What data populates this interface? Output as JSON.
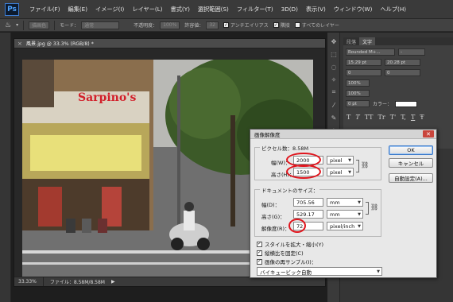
{
  "app": {
    "logo": "Ps",
    "menu": [
      "ファイル(F)",
      "編集(E)",
      "イメージ(I)",
      "レイヤー(L)",
      "書式(Y)",
      "選択範囲(S)",
      "フィルター(T)",
      "3D(D)",
      "表示(V)",
      "ウィンドウ(W)",
      "ヘルプ(H)"
    ]
  },
  "options_bar": {
    "brush_label": "描画色",
    "mode_label": "モード：",
    "mode_value": "通常",
    "opacity_label": "不透明度：",
    "opacity_value": "100%",
    "tolerance_label": "許容値：",
    "tolerance_value": "32",
    "antialias_label": "アンチエイリアス",
    "contiguous_label": "隣接",
    "all_layers_label": "すべてのレイヤー"
  },
  "document": {
    "tab_title": "風景.jpg @ 33.3% (RGB/8) *",
    "zoom": "33.33%",
    "file_info": "ファイル：8.58M/8.58M",
    "sign_text": "Sarpino's"
  },
  "char_panel": {
    "tabs": [
      "段落",
      "文字"
    ],
    "font_family": "Rounded M+...",
    "font_size": "15.29 pt",
    "leading": "20.28 pt",
    "kerning": "0",
    "tracking": "0",
    "vertical_scale": "100%",
    "horizontal_scale": "100%",
    "baseline": "0 pt",
    "color_label": "カラー：",
    "glyphs": [
      "T",
      "T",
      "TT",
      "Tr",
      "T'",
      "T,",
      "T",
      "Ŧ"
    ]
  },
  "dialog": {
    "title": "画像解像度",
    "pixel_dims_label": "ピクセル数：8.58M",
    "width_label": "幅(W)：",
    "width_value": "2000",
    "width_unit": "pixel",
    "height_label": "高さ(H)：",
    "height_value": "1500",
    "height_unit": "pixel",
    "doc_size_label": "ドキュメントのサイズ：",
    "doc_width_label": "幅(D)：",
    "doc_width_value": "705.56",
    "doc_width_unit": "mm",
    "doc_height_label": "高さ(G)：",
    "doc_height_value": "529.17",
    "doc_height_unit": "mm",
    "resolution_label": "解像度(R)：",
    "resolution_value": "72",
    "resolution_unit": "pixel/inch",
    "scale_styles_label": "スタイルを拡大・縮小(Y)",
    "constrain_label": "縦横比を固定(C)",
    "resample_label": "画像の再サンプル(I)：",
    "resample_method": "バイキュービック自動",
    "ok_label": "OK",
    "cancel_label": "キャンセル",
    "auto_label": "自動設定(A)..."
  }
}
